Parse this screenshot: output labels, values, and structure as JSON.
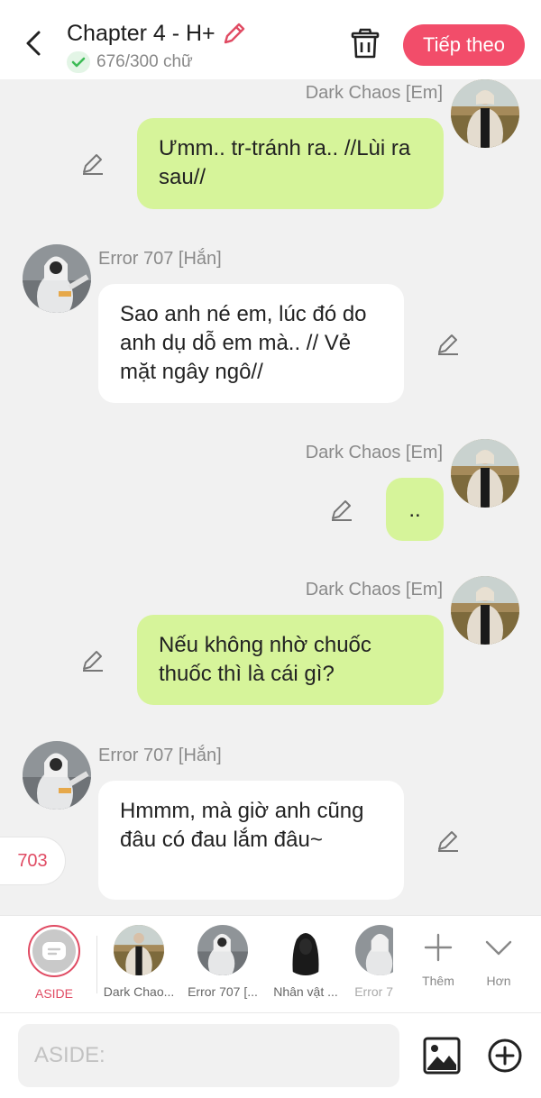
{
  "header": {
    "title": "Chapter 4 - H+",
    "word_count": "676/300 chữ",
    "next_label": "Tiếp theo"
  },
  "messages": [
    {
      "sender": "Dark Chaos [Em]",
      "text": "Ưmm.. tr-tránh ra.. //Lùi ra sau//",
      "side": "right"
    },
    {
      "sender": "Error 707 [Hắn]",
      "text": "Sao anh né em, lúc đó do anh dụ dỗ em mà.. // Vẻ mặt ngây ngô//",
      "side": "left"
    },
    {
      "sender": "Dark Chaos [Em]",
      "text": "..",
      "side": "right"
    },
    {
      "sender": "Dark Chaos [Em]",
      "text": "Nếu không nhờ chuốc thuốc thì là cái gì?",
      "side": "right"
    },
    {
      "sender": "Error 707 [Hắn]",
      "text": "Hmmm, mà giờ anh cũng đâu có đau lắm đâu~",
      "side": "left"
    }
  ],
  "page_badge": "703",
  "characters": {
    "aside": "ASIDE",
    "items": [
      "Dark Chao...",
      "Error 707 [...",
      "Nhân vật ...",
      "Error 7"
    ],
    "add_label": "Thêm",
    "more_label": "Hơn"
  },
  "input": {
    "placeholder": "ASIDE:"
  },
  "colors": {
    "accent": "#f24d6a",
    "green_bubble": "#d6f49a",
    "background": "#f1f1f1"
  }
}
